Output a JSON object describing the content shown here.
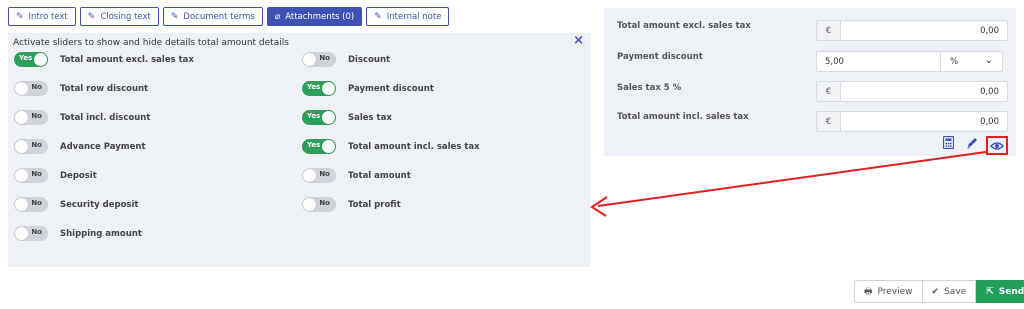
{
  "tabs": [
    {
      "label": "Intro text",
      "icon": "edit-icon",
      "active": false
    },
    {
      "label": "Closing text",
      "icon": "edit-icon",
      "active": false
    },
    {
      "label": "Document terms",
      "icon": "edit-icon",
      "active": false
    },
    {
      "label": "Attachments (0)",
      "icon": "paperclip-icon",
      "active": true
    },
    {
      "label": "Internal note",
      "icon": "edit-icon",
      "active": false
    }
  ],
  "panel": {
    "heading": "Activate sliders to show and hide details total amount details",
    "close": "×",
    "left": [
      {
        "label": "Total amount excl. sales tax",
        "state": "Yes"
      },
      {
        "label": "Total row discount",
        "state": "No"
      },
      {
        "label": "Total incl. discount",
        "state": "No"
      },
      {
        "label": "Advance Payment",
        "state": "No"
      },
      {
        "label": "Deposit",
        "state": "No"
      },
      {
        "label": "Security deposit",
        "state": "No"
      },
      {
        "label": "Shipping amount",
        "state": "No"
      }
    ],
    "right": [
      {
        "label": "Discount",
        "state": "No"
      },
      {
        "label": "Payment discount",
        "state": "Yes"
      },
      {
        "label": "Sales tax",
        "state": "Yes"
      },
      {
        "label": "Total amount incl. sales tax",
        "state": "Yes"
      },
      {
        "label": "Total amount",
        "state": "No"
      },
      {
        "label": "Total profit",
        "state": "No"
      }
    ]
  },
  "totals": {
    "excl_label": "Total amount excl. sales tax",
    "excl_currency": "€",
    "excl_value": "0,00",
    "payment_discount_label": "Payment discount",
    "payment_discount_value": "5,00",
    "payment_discount_unit": "%",
    "sales_tax_label": "Sales tax  5 %",
    "sales_tax_currency": "€",
    "sales_tax_value": "0,00",
    "incl_label": "Total amount incl. sales tax",
    "incl_currency": "€",
    "incl_value": "0,00"
  },
  "actions": {
    "preview": "Preview",
    "save": "Save",
    "send": "Send"
  },
  "colors": {
    "accent": "#3f51b5",
    "toggle_on": "#2e9e5b",
    "toggle_off": "#cfd3da",
    "highlight": "#e02020",
    "send": "#22a05a"
  }
}
